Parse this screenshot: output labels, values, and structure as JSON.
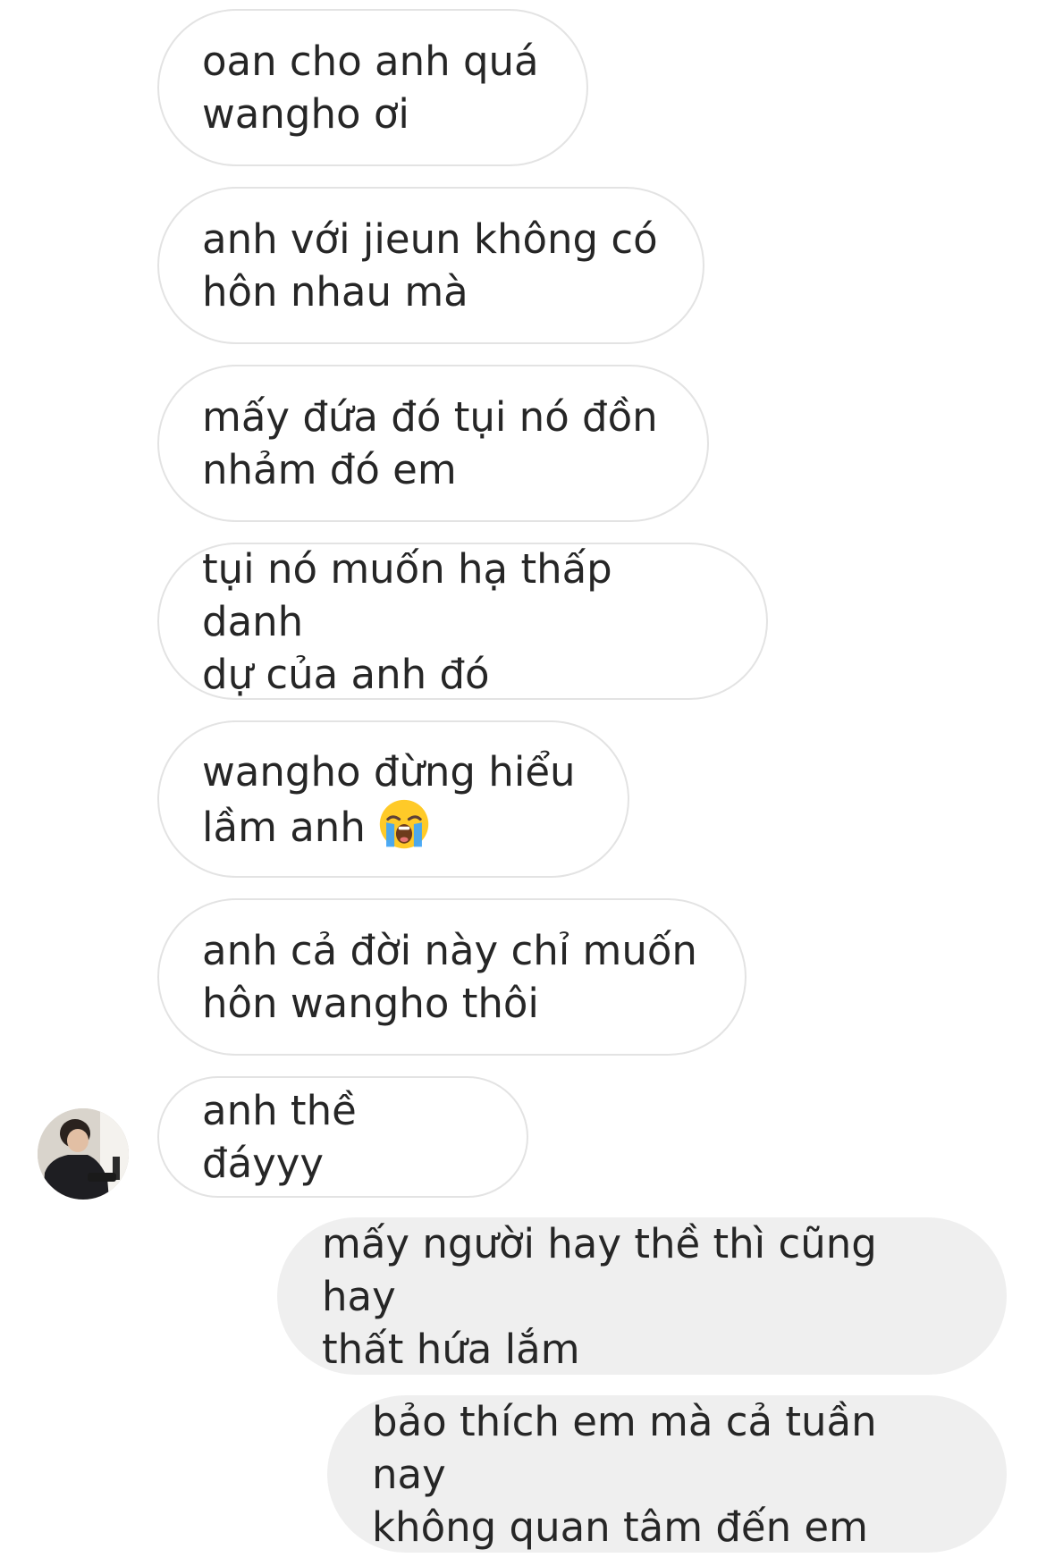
{
  "conversation": {
    "incoming_messages": [
      {
        "text": "oan cho anh quá\nwangho ơi"
      },
      {
        "text": "anh với jieun không có\nhôn nhau mà"
      },
      {
        "text": "mấy đứa đó tụi nó đồn\nnhảm đó em"
      },
      {
        "text": "tụi nó muốn hạ thấp danh\ndự của anh đó"
      },
      {
        "text": "wangho đừng hiểu\nlầm anh",
        "emoji": "loudly-crying-face-icon"
      },
      {
        "text": "anh cả đời này chỉ muốn\nhôn wangho thôi"
      },
      {
        "text": "anh thề đáyyy"
      }
    ],
    "outgoing_messages": [
      {
        "text": "mấy người hay thề thì cũng hay\nthất hứa lắm"
      },
      {
        "text": "bảo thích em mà cả tuần nay\nkhông quan tâm đến em"
      }
    ],
    "avatar_icon": "profile-photo-avatar",
    "colors": {
      "incoming_bubble_border": "#e3e3e3",
      "outgoing_bubble_background": "#efefef",
      "text": "#262626"
    }
  }
}
